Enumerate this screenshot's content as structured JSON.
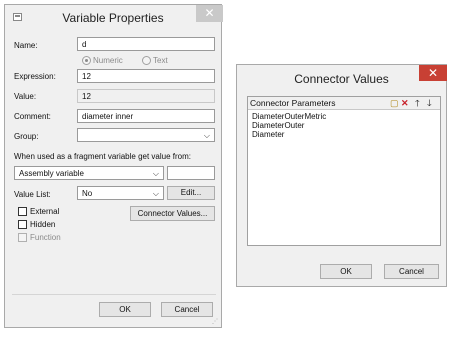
{
  "variable_properties": {
    "title": "Variable Properties",
    "close_glyph": "✕",
    "name_label": "Name:",
    "name_value": "d",
    "numeric_label": "Numeric",
    "text_label": "Text",
    "expression_label": "Expression:",
    "expression_value": "12",
    "value_label": "Value:",
    "value_value": "12",
    "comment_label": "Comment:",
    "comment_value": "diameter inner",
    "group_label": "Group:",
    "group_value": "",
    "fragment_label": "When used as a fragment variable get value from:",
    "fragment_value": "Assembly variable",
    "fragment_extra": "",
    "value_list_label": "Value List:",
    "value_list_value": "No",
    "edit_button": "Edit...",
    "external_label": "External",
    "hidden_label": "Hidden",
    "function_label": "Function",
    "connector_values_button": "Connector Values...",
    "ok_button": "OK",
    "cancel_button": "Cancel"
  },
  "connector_values": {
    "title": "Connector Values",
    "close_glyph": "✕",
    "list_header": "Connector Parameters",
    "items": [
      "DiameterOuterMetric",
      "DiameterOuter",
      "Diameter"
    ],
    "ok_button": "OK",
    "cancel_button": "Cancel"
  },
  "colors": {
    "close_active": "#c84034",
    "close_inactive": "#c9c9c9",
    "window_bg": "#f0f0f0"
  },
  "icons": [
    "new-icon",
    "delete-icon",
    "arrow-up-icon",
    "arrow-down-icon",
    "chevron-down-icon",
    "resize-grip-icon"
  ]
}
